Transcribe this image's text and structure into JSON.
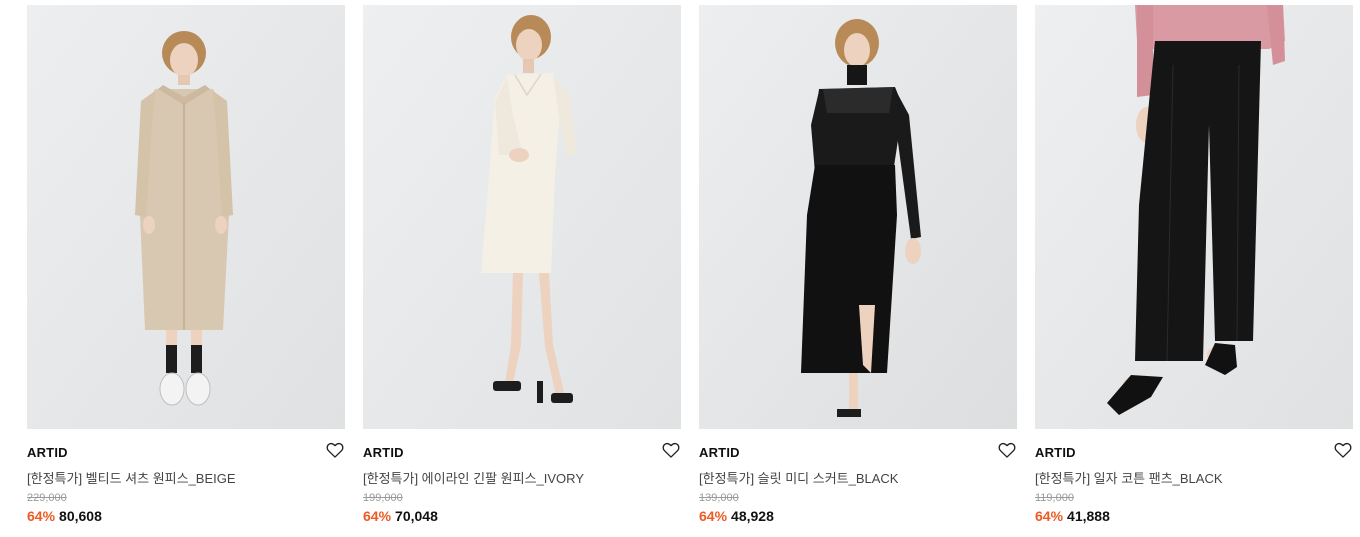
{
  "colors": {
    "discount": "#f05a22",
    "text": "#111111",
    "muted": "#9a9a9a"
  },
  "products": [
    {
      "brand": "ARTID",
      "name": "[한정특가] 벨티드 셔츠 원피스_BEIGE",
      "original_price": "229,000",
      "discount": "64%",
      "sale_price": "80,608",
      "wishlist_icon": "heart-outline-icon"
    },
    {
      "brand": "ARTID",
      "name": "[한정특가] 에이라인 긴팔 원피스_IVORY",
      "original_price": "199,000",
      "discount": "64%",
      "sale_price": "70,048",
      "wishlist_icon": "heart-outline-icon"
    },
    {
      "brand": "ARTID",
      "name": "[한정특가] 슬릿 미디 스커트_BLACK",
      "original_price": "139,000",
      "discount": "64%",
      "sale_price": "48,928",
      "wishlist_icon": "heart-outline-icon"
    },
    {
      "brand": "ARTID",
      "name": "[한정특가] 일자 코튼 팬츠_BLACK",
      "original_price": "119,000",
      "discount": "64%",
      "sale_price": "41,888",
      "wishlist_icon": "heart-outline-icon"
    }
  ]
}
